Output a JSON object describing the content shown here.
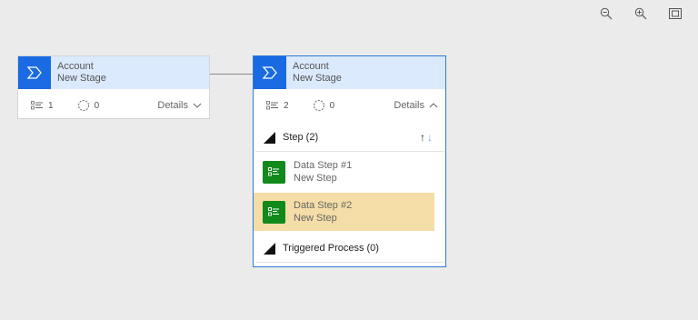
{
  "toolbar": {
    "zoom_out_icon": "zoom-out-icon",
    "zoom_in_icon": "zoom-in-icon",
    "fit_icon": "fit-to-screen-icon"
  },
  "colors": {
    "canvas": "#ebebeb",
    "stage_header": "#dbe9fd",
    "stage_icon": "#1a6ae3",
    "selected_border": "#2b7bd7",
    "step_icon": "#118a1b",
    "highlight": "#f5dda7"
  },
  "stages": [
    {
      "entity": "Account",
      "name": "New Stage",
      "steps_count": "1",
      "conditions_count": "0",
      "details_label": "Details",
      "expanded": false
    },
    {
      "entity": "Account",
      "name": "New Stage",
      "steps_count": "2",
      "conditions_count": "0",
      "details_label": "Details",
      "expanded": true,
      "step_section_label": "Step (2)",
      "steps": [
        {
          "title": "Data Step #1",
          "subtitle": "New Step",
          "selected": false
        },
        {
          "title": "Data Step #2",
          "subtitle": "New Step",
          "selected": true
        }
      ],
      "triggered_label": "Triggered Process (0)"
    }
  ]
}
